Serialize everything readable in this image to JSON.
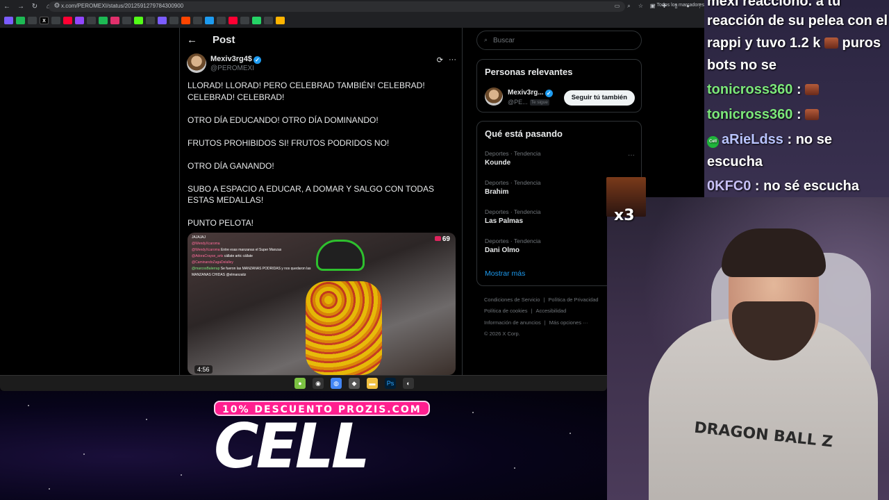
{
  "browser": {
    "url": "x.com/PEROMEXI/status/2012591279784300900",
    "bookmarks_folder": "Todos los marcadores"
  },
  "post": {
    "header_title": "Post",
    "author_name": "Mexiv3rg4$",
    "author_handle": "@PEROMEXI",
    "paragraphs": [
      "LLORAD! LLORAD! PERO CELEBRAD TAMBIÉN! CELEBRAD! CELEBRAD! CELEBRAD!",
      "OTRO DÍA EDUCANDO! OTRO DÍA DOMINANDO!",
      "FRUTOS PROHIBIDOS SI! FRUTOS PODRIDOS NO!",
      "OTRO DÍA GANANDO!",
      "SUBO A ESPACIO A EDUCAR, A DOMAR Y SALGO CON TODAS ESTAS MEDALLAS!",
      "PUNTO PELOTA!"
    ],
    "media": {
      "viewers": "69",
      "duration": "4:56",
      "chat_lines": [
        {
          "name": "JAJAJAJ",
          "text": ""
        },
        {
          "name": "@WendyXcaroma",
          "text": ""
        },
        {
          "name": "@WendyXcaroma",
          "text": "Entre esas manzanas el Super Manzas"
        },
        {
          "name": "@AdoraCrayse_arts",
          "text": "cállate artic cállate"
        },
        {
          "name": "@CaminandoZagaDelalley",
          "text": ""
        },
        {
          "name": "@marcosBalerrap",
          "text": "Se fueron las MANZANAS PODRIDAS y nos quedaron las"
        },
        {
          "name": "",
          "text": "MANZANAS CHIDAS @elmanzatiz"
        }
      ]
    }
  },
  "sidebar": {
    "search_placeholder": "Buscar",
    "relevant_title": "Personas relevantes",
    "relevant_user": {
      "name": "Mexiv3rg...",
      "handle": "@PE...",
      "follows_you": "Te sigue",
      "button": "Seguir tú también"
    },
    "trending_title": "Qué está pasando",
    "trends": [
      {
        "meta": "Deportes · Tendencia",
        "name": "Kounde"
      },
      {
        "meta": "Deportes · Tendencia",
        "name": "Brahim"
      },
      {
        "meta": "Deportes · Tendencia",
        "name": "Las Palmas"
      },
      {
        "meta": "Deportes · Tendencia",
        "name": "Dani Olmo"
      }
    ],
    "show_more": "Mostrar más",
    "footer_links": [
      "Condiciones de Servicio",
      "Política de Privacidad",
      "Política de cookies",
      "Accesibilidad",
      "Información de anuncios",
      "Más opciones ···",
      "© 2026 X Corp."
    ]
  },
  "stream": {
    "promo": "10% DESCUENTO PROZIS.COM",
    "brand": "CELL",
    "emote_multiplier": "x3",
    "hoodie_print": "DRAGON BALL Z",
    "chat": [
      {
        "user": "",
        "text": "mexi reacciono. a tu"
      },
      {
        "user": "",
        "text": "reacción de su pelea con el"
      },
      {
        "user": "",
        "text": "rappi y tuvo 1.2 k"
      },
      {
        "user": "",
        "text": "puros"
      },
      {
        "user": "",
        "text": "bots no se"
      },
      {
        "user": "tonicross360",
        "text": ":"
      },
      {
        "user": "tonicross360",
        "text": ":"
      },
      {
        "user": "aRieLdss",
        "text": ": no se"
      },
      {
        "user": "",
        "text": "escucha"
      },
      {
        "user": "0KFC0",
        "text": ": no sé escucha"
      }
    ],
    "chat_badge": "Cell"
  }
}
